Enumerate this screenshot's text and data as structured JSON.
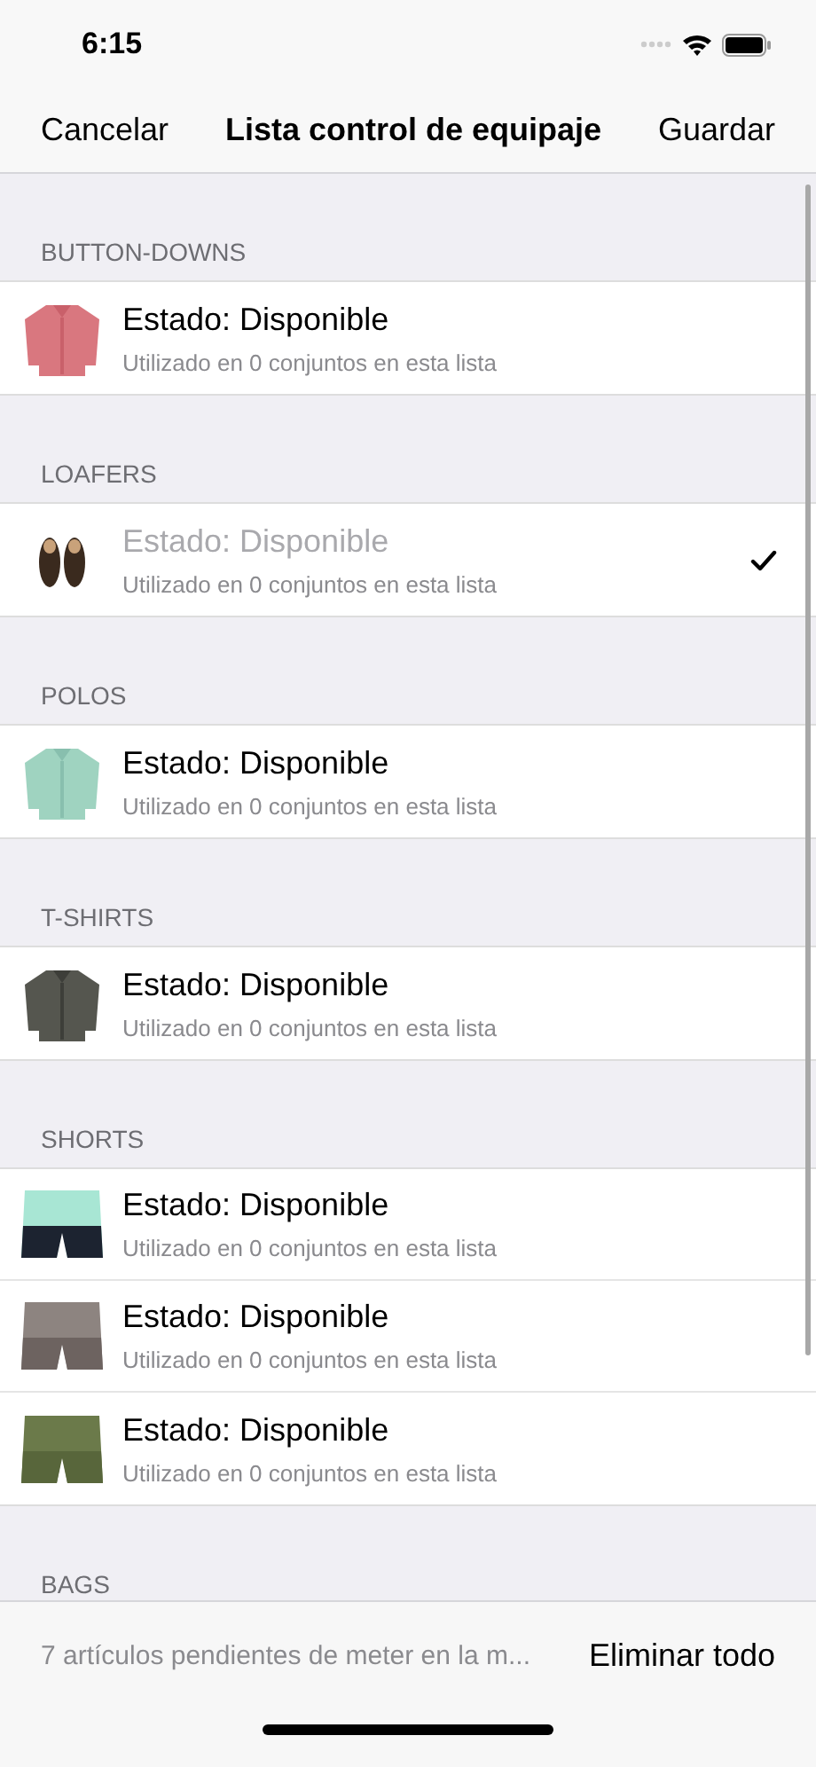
{
  "status_bar": {
    "time": "6:15"
  },
  "nav": {
    "cancel": "Cancelar",
    "title": "Lista control de equipaje",
    "save": "Guardar"
  },
  "sections": [
    {
      "header": "BUTTON-DOWNS",
      "items": [
        {
          "kind": "picture",
          "title": "Estado: Disponible",
          "subtitle": "Utilizado en 0 conjuntos en esta lista",
          "checked": false
        }
      ]
    },
    {
      "header": "LOAFERS",
      "items": [
        {
          "kind": "picture",
          "title": "Estado: Disponible",
          "subtitle": "Utilizado en 0 conjuntos en esta lista",
          "checked": true
        }
      ]
    },
    {
      "header": "POLOS",
      "items": [
        {
          "kind": "picture",
          "title": "Estado: Disponible",
          "subtitle": "Utilizado en 0 conjuntos en esta lista",
          "checked": false
        }
      ]
    },
    {
      "header": "T-SHIRTS",
      "items": [
        {
          "kind": "picture",
          "title": "Estado: Disponible",
          "subtitle": "Utilizado en 0 conjuntos en esta lista",
          "checked": false
        }
      ]
    },
    {
      "header": "SHORTS",
      "items": [
        {
          "kind": "picture",
          "title": "Estado: Disponible",
          "subtitle": "Utilizado en 0 conjuntos en esta lista",
          "checked": false
        },
        {
          "kind": "picture",
          "title": "Estado: Disponible",
          "subtitle": "Utilizado en 0 conjuntos en esta lista",
          "checked": false
        },
        {
          "kind": "picture",
          "title": "Estado: Disponible",
          "subtitle": "Utilizado en 0 conjuntos en esta lista",
          "checked": false
        }
      ]
    },
    {
      "header": "BAGS"
    }
  ],
  "toolbar": {
    "summary": "7 artículos pendientes de meter en la m...",
    "action": "Eliminar todo"
  }
}
